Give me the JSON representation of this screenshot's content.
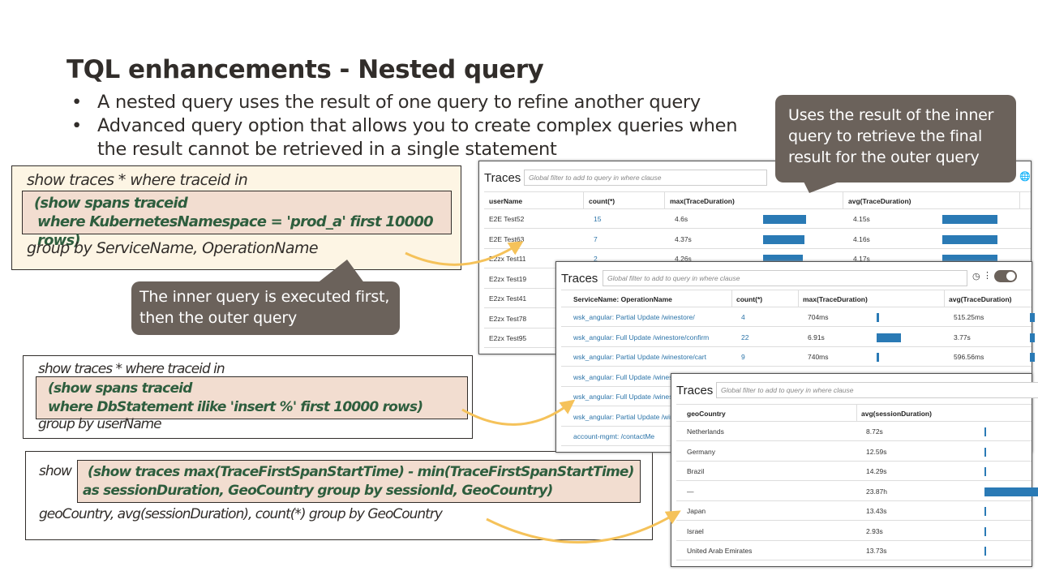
{
  "slide": {
    "title": "TQL enhancements - Nested query",
    "bullets": [
      "A nested query uses the result of one query to refine another query",
      "Advanced query option that allows you to create complex queries when the result cannot be retrieved in a single statement"
    ]
  },
  "callouts": {
    "outer": "Uses the result of the inner query to retrieve the final result for the outer query",
    "inner": "The inner query is executed first, then the outer query"
  },
  "queries": [
    {
      "outer_before": "show traces * where traceid in",
      "inner": [
        "(show spans traceid",
        "where KubernetesNamespace = 'prod_a' first 10000 rows)"
      ],
      "outer_after": "group by ServiceName, OperationName"
    },
    {
      "outer_before": "show traces * where traceid in",
      "inner": [
        "(show spans traceid",
        "where DbStatement ilike 'insert %' first 10000 rows)"
      ],
      "outer_after": "group by userName"
    },
    {
      "outer_before": "show",
      "inner": [
        "(show traces max(TraceFirstSpanStartTime) -  min(TraceFirstSpanStartTime)",
        "as sessionDuration, GeoCountry group by sessionId, GeoCountry)"
      ],
      "outer_after": "geoCountry, avg(sessionDuration), count(*) group by GeoCountry"
    }
  ],
  "colors": {
    "bar": "#2a7ab5",
    "link": "#2a73a8",
    "inner_query_text": "#2e5e3e",
    "callout": "#6b625b",
    "arrow": "#f5c25a",
    "query_bg": "#fdf5e4",
    "inner_bg": "#f2ddd0"
  },
  "windows": [
    {
      "title": "Traces",
      "search_placeholder": "Global filter to add to query in where clause",
      "columns": [
        "userName",
        "count(*)",
        "max(TraceDuration)",
        "avg(TraceDuration)"
      ],
      "rows": [
        [
          "E2E Test52",
          "15",
          "4.6s",
          "4.15s"
        ],
        [
          "E2E Test63",
          "7",
          "4.37s",
          "4.16s"
        ],
        [
          "E2zx Test11",
          "2",
          "4.26s",
          "4.17s"
        ],
        [
          "E2zx Test19"
        ],
        [
          "E2zx Test41"
        ],
        [
          "E2zx Test78"
        ],
        [
          "E2zx Test95"
        ]
      ]
    },
    {
      "title": "Traces",
      "search_placeholder": "Global filter to add to query in where clause",
      "columns": [
        "ServiceName: OperationName",
        "count(*)",
        "max(TraceDuration)",
        "avg(TraceDuration)"
      ],
      "rows": [
        [
          "wsk_angular: Partial Update /winestore/",
          "4",
          "704ms",
          "515.25ms"
        ],
        [
          "wsk_angular: Full Update /winestore/confirm",
          "22",
          "6.91s",
          "3.77s"
        ],
        [
          "wsk_angular: Partial Update /winestore/cart",
          "9",
          "740ms",
          "596.56ms"
        ],
        [
          "wsk_angular: Full Update /winest"
        ],
        [
          "wsk_angular: Full Update /winest"
        ],
        [
          "wsk_angular: Partial Update /win"
        ],
        [
          "account-mgmt: /contactMe"
        ]
      ]
    },
    {
      "title": "Traces",
      "search_placeholder": "Global filter to add to query in where clause",
      "columns": [
        "geoCountry",
        "avg(sessionDuration)"
      ],
      "rows": [
        [
          "Netherlands",
          "8.72s"
        ],
        [
          "Germany",
          "12.59s"
        ],
        [
          "Brazil",
          "14.29s"
        ],
        [
          "—",
          "23.87h"
        ],
        [
          "Japan",
          "13.43s"
        ],
        [
          "Israel",
          "2.93s"
        ],
        [
          "United Arab Emirates",
          "13.73s"
        ]
      ]
    }
  ]
}
